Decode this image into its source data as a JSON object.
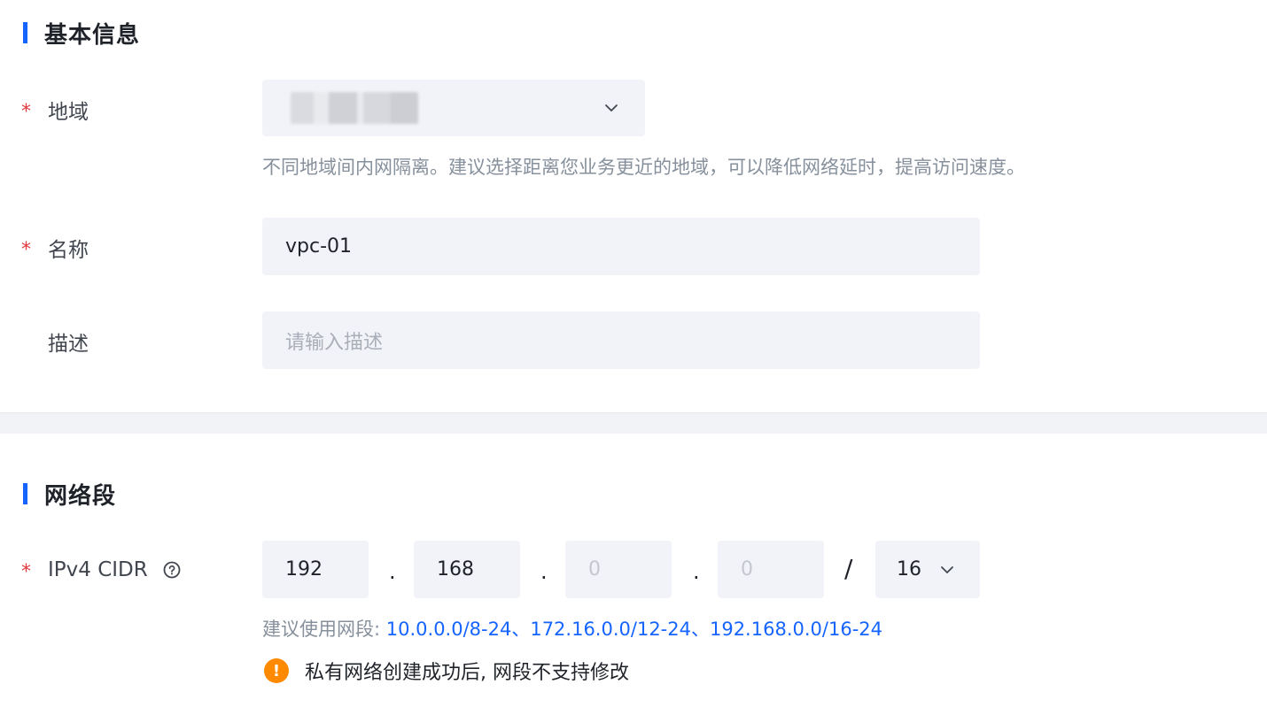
{
  "basic_info": {
    "title": "基本信息",
    "region": {
      "label": "地域",
      "required_mark": "*",
      "hint": "不同地域间内网隔离。建议选择距离您业务更近的地域，可以降低网络延时，提高访问速度。",
      "icon": "chevron-down-icon"
    },
    "name": {
      "label": "名称",
      "required_mark": "*",
      "value": "vpc-01"
    },
    "description": {
      "label": "描述",
      "value": "",
      "placeholder": "请输入描述"
    }
  },
  "network_segment": {
    "title": "网络段",
    "cidr": {
      "label": "IPv4 CIDR",
      "required_mark": "*",
      "help_icon": "question-circle-icon",
      "octet1": "192",
      "octet2": "168",
      "octet3_placeholder": "0",
      "octet4_placeholder": "0",
      "dot": ".",
      "slash": "/",
      "mask": "16",
      "mask_icon": "chevron-down-icon"
    },
    "suggestion": {
      "prefix": "建议使用网段:",
      "ranges": "10.0.0.0/8-24、172.16.0.0/12-24、192.168.0.0/16-24"
    },
    "warning": {
      "icon": "warning-circle-icon",
      "text": "私有网络创建成功后, 网段不支持修改"
    }
  },
  "colors": {
    "accent": "#1664ff",
    "required": "#e0393e",
    "warning": "#ff8a00",
    "field_bg": "#f2f3f8"
  }
}
